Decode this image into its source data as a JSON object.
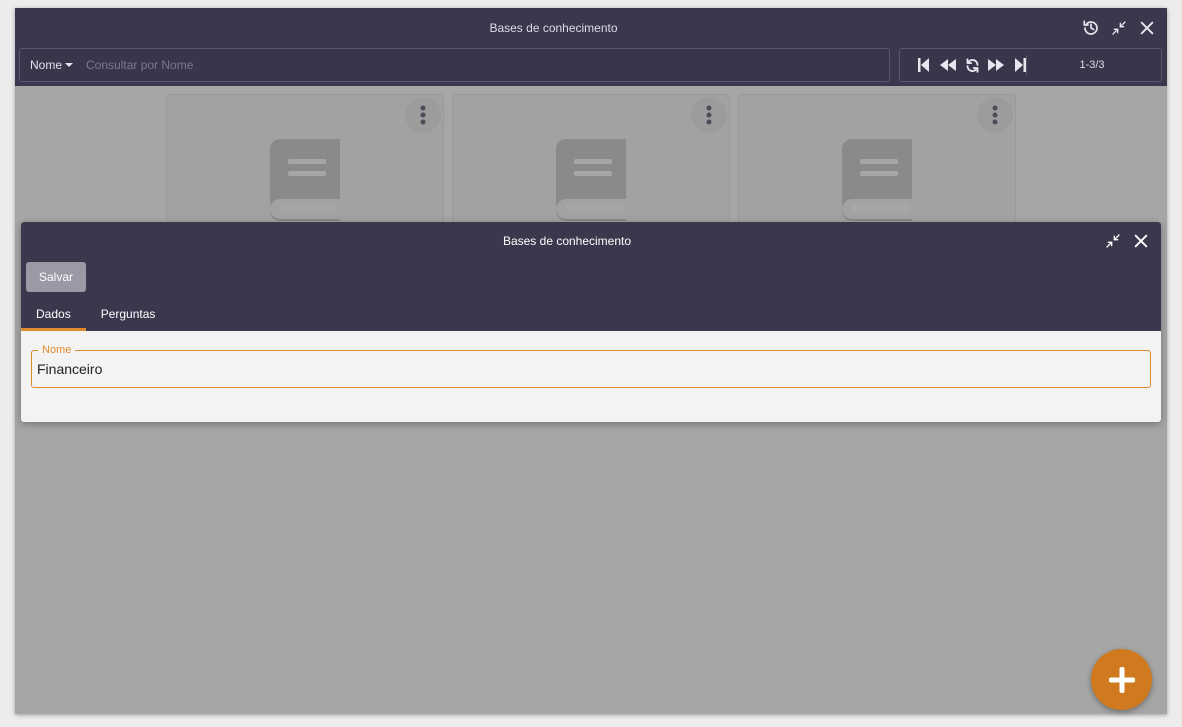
{
  "main_window": {
    "title": "Bases de conhecimento",
    "search": {
      "field_label": "Nome",
      "placeholder": "Consultar por Nome",
      "value": ""
    },
    "pager": {
      "count": "1-3/3"
    },
    "cards": [
      {
        "icon": "book-icon"
      },
      {
        "icon": "book-icon"
      },
      {
        "icon": "book-icon"
      }
    ]
  },
  "dialog": {
    "title": "Bases de conhecimento",
    "save_label": "Salvar",
    "tabs": [
      {
        "label": "Dados",
        "active": true
      },
      {
        "label": "Perguntas",
        "active": false
      }
    ],
    "field": {
      "label": "Nome",
      "value": "Financeiro"
    }
  },
  "colors": {
    "header": "#3a384d",
    "accent": "#e08a2e",
    "fab": "#cf7a1f",
    "overlay": "#a6a6a6"
  }
}
